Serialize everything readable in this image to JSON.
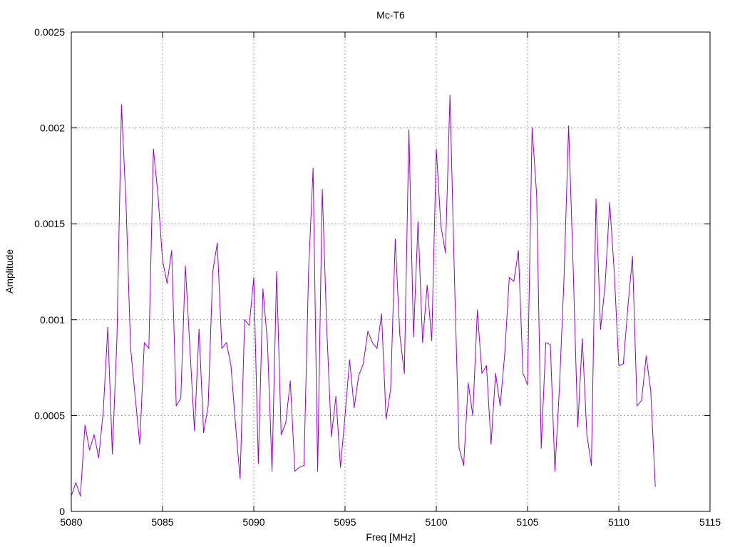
{
  "chart_data": {
    "type": "line",
    "title": "Mc-T6",
    "xlabel": "Freq [MHz]",
    "ylabel": "Amplitude",
    "xlim": [
      5080,
      5115
    ],
    "ylim": [
      0,
      0.0025
    ],
    "xticks": [
      "5080",
      "5085",
      "5090",
      "5095",
      "5100",
      "5105",
      "5110",
      "5115"
    ],
    "yticks": [
      "0",
      "0.0005",
      "0.001",
      "0.0015",
      "0.002",
      "0.0025"
    ],
    "grid": true,
    "legend": "none",
    "series": [
      {
        "color": "#9400d3",
        "x": [
          5080.0,
          5080.25,
          5080.5,
          5080.75,
          5081.0,
          5081.25,
          5081.5,
          5081.75,
          5082.0,
          5082.25,
          5082.5,
          5082.75,
          5083.0,
          5083.25,
          5083.5,
          5083.75,
          5084.0,
          5084.25,
          5084.5,
          5084.75,
          5085.0,
          5085.25,
          5085.5,
          5085.75,
          5086.0,
          5086.25,
          5086.5,
          5086.75,
          5087.0,
          5087.25,
          5087.5,
          5087.75,
          5088.0,
          5088.25,
          5088.5,
          5088.75,
          5089.0,
          5089.25,
          5089.5,
          5089.75,
          5090.0,
          5090.25,
          5090.5,
          5090.75,
          5091.0,
          5091.25,
          5091.5,
          5091.75,
          5092.0,
          5092.25,
          5092.5,
          5092.75,
          5093.0,
          5093.25,
          5093.5,
          5093.75,
          5094.0,
          5094.25,
          5094.5,
          5094.75,
          5095.0,
          5095.25,
          5095.5,
          5095.75,
          5096.0,
          5096.25,
          5096.5,
          5096.75,
          5097.0,
          5097.25,
          5097.5,
          5097.75,
          5098.0,
          5098.25,
          5098.5,
          5098.75,
          5099.0,
          5099.25,
          5099.5,
          5099.75,
          5100.0,
          5100.25,
          5100.5,
          5100.75,
          5101.0,
          5101.25,
          5101.5,
          5101.75,
          5102.0,
          5102.25,
          5102.5,
          5102.75,
          5103.0,
          5103.25,
          5103.5,
          5103.75,
          5104.0,
          5104.25,
          5104.5,
          5104.75,
          5105.0,
          5105.25,
          5105.5,
          5105.75,
          5106.0,
          5106.25,
          5106.5,
          5106.75,
          5107.0,
          5107.25,
          5107.5,
          5107.75,
          5108.0,
          5108.25,
          5108.5,
          5108.75,
          5109.0,
          5109.25,
          5109.5,
          5109.75,
          5110.0,
          5110.25,
          5110.5,
          5110.75,
          5111.0,
          5111.25,
          5111.5,
          5111.75,
          5112.0
        ],
        "y": [
          8e-05,
          0.00015,
          8e-05,
          0.00045,
          0.00032,
          0.0004,
          0.00028,
          0.00052,
          0.00096,
          0.0003,
          0.0009,
          0.00212,
          0.0016,
          0.00085,
          0.0006,
          0.00035,
          0.00088,
          0.00085,
          0.00189,
          0.00165,
          0.00131,
          0.00119,
          0.00136,
          0.00055,
          0.00059,
          0.00128,
          0.00085,
          0.00042,
          0.00095,
          0.00041,
          0.00055,
          0.00125,
          0.0014,
          0.00085,
          0.00088,
          0.00076,
          0.00045,
          0.00017,
          0.001,
          0.00097,
          0.00122,
          0.00025,
          0.00116,
          0.00088,
          0.00021,
          0.00125,
          0.0004,
          0.00046,
          0.00068,
          0.00021,
          0.00023,
          0.00024,
          0.00125,
          0.00179,
          0.00021,
          0.00168,
          0.00095,
          0.00039,
          0.0006,
          0.00023,
          0.0005,
          0.00079,
          0.00054,
          0.00071,
          0.00077,
          0.00094,
          0.00088,
          0.00085,
          0.00103,
          0.00048,
          0.00064,
          0.00142,
          0.00092,
          0.00072,
          0.00199,
          0.00091,
          0.00151,
          0.00088,
          0.00118,
          0.00089,
          0.00189,
          0.00149,
          0.00135,
          0.00217,
          0.0012,
          0.00033,
          0.00024,
          0.00067,
          0.0005,
          0.00105,
          0.00072,
          0.00076,
          0.00035,
          0.00072,
          0.00055,
          0.00082,
          0.00122,
          0.0012,
          0.00136,
          0.00072,
          0.00066,
          0.002,
          0.00165,
          0.00033,
          0.00088,
          0.00087,
          0.00021,
          0.00065,
          0.00122,
          0.00201,
          0.00127,
          0.00044,
          0.0009,
          0.0004,
          0.00024,
          0.00163,
          0.00095,
          0.00118,
          0.00161,
          0.00125,
          0.00076,
          0.00077,
          0.00107,
          0.00133,
          0.00055,
          0.00058,
          0.00081,
          0.00063,
          0.00013
        ]
      }
    ]
  }
}
